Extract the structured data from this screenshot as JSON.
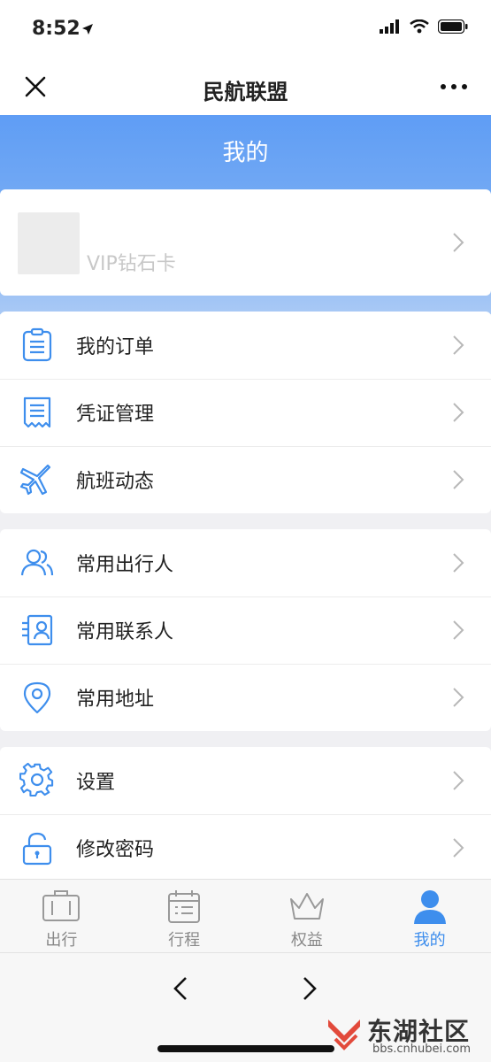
{
  "status": {
    "time": "8:52"
  },
  "nav": {
    "title": "民航联盟"
  },
  "banner": {
    "title": "我的"
  },
  "card": {
    "tier": "VIP钻石卡"
  },
  "groups": [
    {
      "items": [
        {
          "label": "我的订单",
          "icon": "order-list-icon"
        },
        {
          "label": "凭证管理",
          "icon": "receipt-icon"
        },
        {
          "label": "航班动态",
          "icon": "airplane-icon"
        }
      ]
    },
    {
      "items": [
        {
          "label": "常用出行人",
          "icon": "travelers-icon"
        },
        {
          "label": "常用联系人",
          "icon": "contact-card-icon"
        },
        {
          "label": "常用地址",
          "icon": "location-pin-icon"
        }
      ]
    },
    {
      "items": [
        {
          "label": "设置",
          "icon": "gear-icon"
        },
        {
          "label": "修改密码",
          "icon": "lock-icon"
        }
      ]
    }
  ],
  "tabs": [
    {
      "label": "出行",
      "icon": "suitcase-icon",
      "active": false
    },
    {
      "label": "行程",
      "icon": "calendar-list-icon",
      "active": false
    },
    {
      "label": "权益",
      "icon": "crown-icon",
      "active": false
    },
    {
      "label": "我的",
      "icon": "person-icon",
      "active": true
    }
  ],
  "watermark": {
    "brand": "东湖社区",
    "url": "bbs.cnhubei.com"
  },
  "colors": {
    "accent": "#3e8eed",
    "icon_stroke": "#3e8eed",
    "banner_top": "#5f9df5"
  }
}
